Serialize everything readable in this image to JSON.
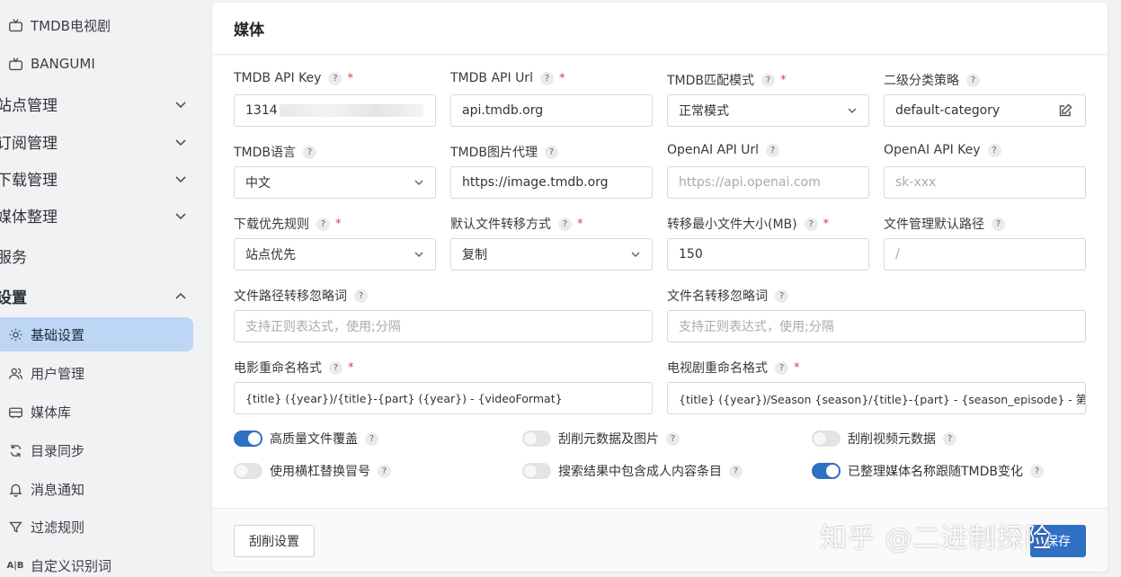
{
  "sidebar": {
    "items": [
      {
        "label": "TMDB电视剧",
        "icon": "tv-icon"
      },
      {
        "label": "BANGUMI",
        "icon": "tv-icon"
      },
      {
        "label": "站点管理"
      },
      {
        "label": "订阅管理"
      },
      {
        "label": "下载管理"
      },
      {
        "label": "媒体整理"
      },
      {
        "label": "服务"
      },
      {
        "label": "设置"
      },
      {
        "label": "基础设置",
        "icon": "gear-icon"
      },
      {
        "label": "用户管理",
        "icon": "users-icon"
      },
      {
        "label": "媒体库",
        "icon": "library-icon"
      },
      {
        "label": "目录同步",
        "icon": "sync-icon"
      },
      {
        "label": "消息通知",
        "icon": "bell-icon"
      },
      {
        "label": "过滤规则",
        "icon": "filter-icon"
      },
      {
        "label": "自定义识别词",
        "icon": "text-icon"
      }
    ]
  },
  "card": {
    "title": "媒体",
    "fields": {
      "tmdb_api_key": {
        "label": "TMDB API Key",
        "value": "1314"
      },
      "tmdb_api_url": {
        "label": "TMDB API Url",
        "value": "api.tmdb.org"
      },
      "tmdb_match_mode": {
        "label": "TMDB匹配模式",
        "value": "正常模式"
      },
      "category_policy": {
        "label": "二级分类策略",
        "value": "default-category"
      },
      "tmdb_language": {
        "label": "TMDB语言",
        "value": "中文"
      },
      "tmdb_image_proxy": {
        "label": "TMDB图片代理",
        "value": "https://image.tmdb.org"
      },
      "openai_api_url": {
        "label": "OpenAI API Url",
        "placeholder": "https://api.openai.com"
      },
      "openai_api_key": {
        "label": "OpenAI API Key",
        "placeholder": "sk-xxx"
      },
      "download_priority": {
        "label": "下载优先规则",
        "value": "站点优先"
      },
      "transfer_mode": {
        "label": "默认文件转移方式",
        "value": "复制"
      },
      "min_file_size": {
        "label": "转移最小文件大小(MB)",
        "value": "150"
      },
      "default_path": {
        "label": "文件管理默认路径",
        "placeholder": "/"
      },
      "path_ignore": {
        "label": "文件路径转移忽略词",
        "placeholder": "支持正则表达式，使用;分隔"
      },
      "name_ignore": {
        "label": "文件名转移忽略词",
        "placeholder": "支持正则表达式，使用;分隔"
      },
      "movie_format": {
        "label": "电影重命名格式",
        "value": "{title} ({year})/{title}-{part} ({year}) - {videoFormat}"
      },
      "tv_format": {
        "label": "电视剧重命名格式",
        "value": "{title} ({year})/Season {season}/{title}-{part} - {season_episode} - 第{episode}集"
      }
    },
    "toggles": [
      {
        "label": "高质量文件覆盖",
        "on": true
      },
      {
        "label": "刮削元数据及图片",
        "on": false
      },
      {
        "label": "刮削视频元数据",
        "on": false
      },
      {
        "label": "使用横杠替换冒号",
        "on": false
      },
      {
        "label": "搜索结果中包含成人内容条目",
        "on": false
      },
      {
        "label": "已整理媒体名称跟随TMDB变化",
        "on": true
      }
    ],
    "help_glyph": "?",
    "required_glyph": "*",
    "footer": {
      "scrape_button": "刮削设置",
      "save_button": "保存"
    }
  },
  "watermark": "知乎 @二进制探险"
}
